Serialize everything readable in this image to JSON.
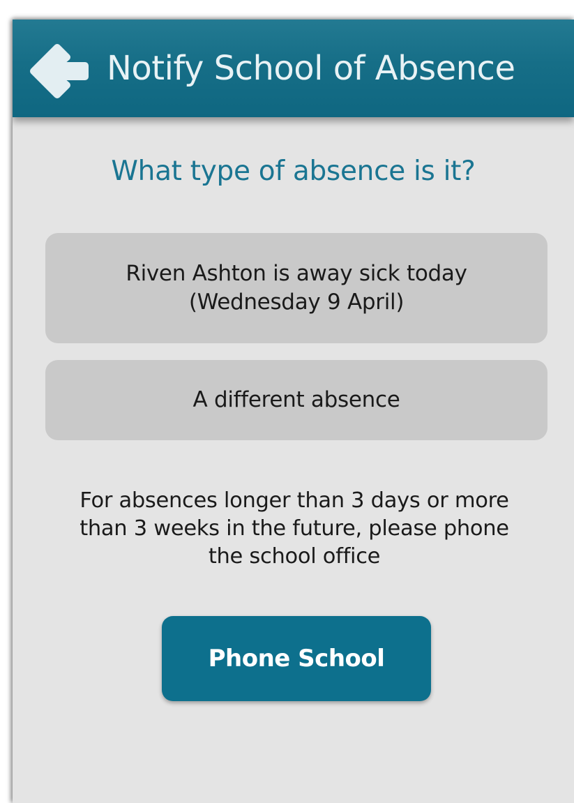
{
  "app_bar": {
    "title": "Notify School of Absence",
    "back_icon": "arrow-left-icon",
    "background_color": "#166e87"
  },
  "question": "What type of absence is it?",
  "options": [
    {
      "lines": [
        "Riven Ashton is away sick today",
        "(Wednesday 9 April)"
      ]
    },
    {
      "lines": [
        "A different absence"
      ]
    }
  ],
  "info_lines": [
    "For absences longer than 3 days or more",
    "than 3 weeks in the future, please phone",
    "the school office"
  ],
  "phone_button_label": "Phone School",
  "colors": {
    "accent": "#1a7592",
    "button": "#0d708d",
    "option_background": "#c9c9c9",
    "page_background": "#e4e4e4"
  }
}
